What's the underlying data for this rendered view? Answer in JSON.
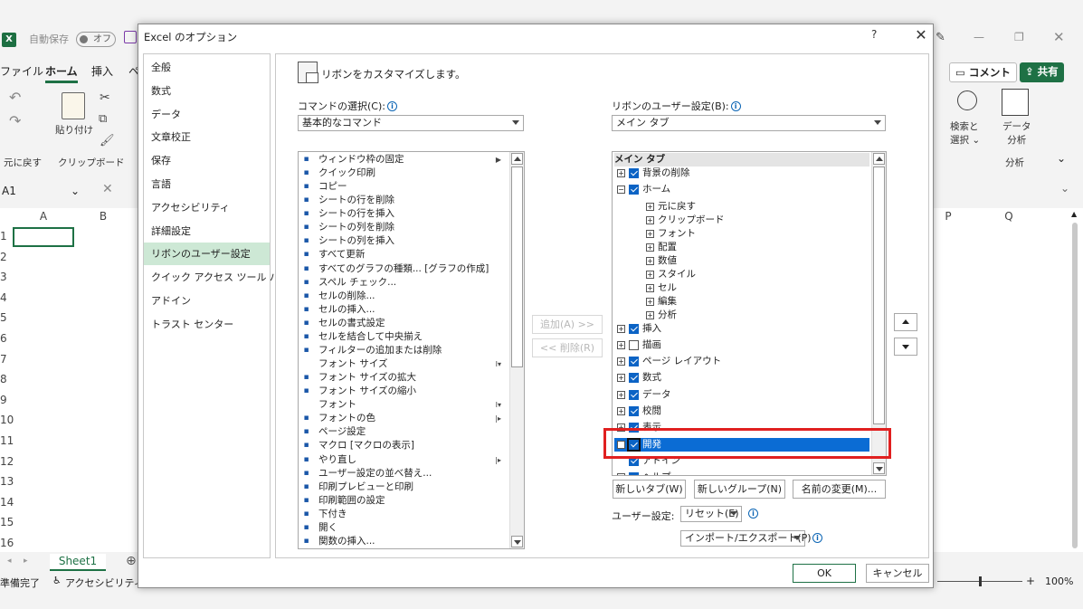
{
  "excel": {
    "app_icon": "excel-icon",
    "autosave_label": "自動保存",
    "autosave_state": "オフ",
    "menu_tabs": [
      "ファイル",
      "ホーム",
      "挿入"
    ],
    "undo_group_label": "元に戻す",
    "clipboard_group_label": "クリップボード",
    "paste_label": "貼り付け",
    "namebox_value": "A1",
    "columns": [
      "A",
      "B",
      "P",
      "Q"
    ],
    "rows": [
      "1",
      "2",
      "3",
      "4",
      "5",
      "6",
      "7",
      "8",
      "9",
      "10",
      "11",
      "12",
      "13",
      "14",
      "15",
      "16"
    ],
    "comment_button": "コメント",
    "share_button": "共有",
    "search_select_label": "検索と",
    "search_select_label2": "選択",
    "data_analysis_label": "データ",
    "data_analysis_label2": "分析",
    "analysis_group_label": "分析",
    "sheet_tab": "Sheet1",
    "status_ready": "準備完了",
    "status_accessibility": "アクセシビリティ: I",
    "zoom": "100%",
    "accent_green": "#1e7145"
  },
  "dialog": {
    "title": "Excel のオプション",
    "help": "?",
    "close": "✕",
    "nav": [
      "全般",
      "数式",
      "データ",
      "文章校正",
      "保存",
      "言語",
      "アクセシビリティ",
      "詳細設定",
      "リボンのユーザー設定",
      "クイック アクセス ツール バー",
      "アドイン",
      "トラスト センター"
    ],
    "nav_selected": "リボンのユーザー設定",
    "heading": "リボンをカスタマイズします。",
    "commands_label": "コマンドの選択(C):",
    "commands_value": "基本的なコマンド",
    "ribbon_label": "リボンのユーザー設定(B):",
    "ribbon_value": "メイン タブ",
    "commands": [
      {
        "icon": "freeze-panes-icon",
        "label": "ウィンドウ枠の固定",
        "sub": "▶"
      },
      {
        "icon": "quick-print-icon",
        "label": "クイック印刷",
        "sub": ""
      },
      {
        "icon": "copy-icon",
        "label": "コピー",
        "sub": ""
      },
      {
        "icon": "delete-sheet-rows-icon",
        "label": "シートの行を削除",
        "sub": ""
      },
      {
        "icon": "insert-sheet-rows-icon",
        "label": "シートの行を挿入",
        "sub": ""
      },
      {
        "icon": "delete-sheet-columns-icon",
        "label": "シートの列を削除",
        "sub": ""
      },
      {
        "icon": "insert-sheet-columns-icon",
        "label": "シートの列を挿入",
        "sub": ""
      },
      {
        "icon": "refresh-all-icon",
        "label": "すべて更新",
        "sub": ""
      },
      {
        "icon": "all-chart-types-icon",
        "label": "すべてのグラフの種類... [グラフの作成]",
        "sub": ""
      },
      {
        "icon": "spelling-icon",
        "label": "スペル チェック...",
        "sub": ""
      },
      {
        "icon": "delete-cells-icon",
        "label": "セルの削除...",
        "sub": ""
      },
      {
        "icon": "insert-cells-icon",
        "label": "セルの挿入...",
        "sub": ""
      },
      {
        "icon": "format-cells-icon",
        "label": "セルの書式設定",
        "sub": ""
      },
      {
        "icon": "merge-center-icon",
        "label": "セルを結合して中央揃え",
        "sub": ""
      },
      {
        "icon": "filter-icon",
        "label": "フィルターの追加または削除",
        "sub": ""
      },
      {
        "icon": "",
        "label": "フォント サイズ",
        "sub": "I▾"
      },
      {
        "icon": "font-size-increase-icon",
        "label": "フォント サイズの拡大",
        "sub": ""
      },
      {
        "icon": "font-size-decrease-icon",
        "label": "フォント サイズの縮小",
        "sub": ""
      },
      {
        "icon": "",
        "label": "フォント",
        "sub": "I▾"
      },
      {
        "icon": "font-color-icon",
        "label": "フォントの色",
        "sub": "|▸"
      },
      {
        "icon": "page-setup-icon",
        "label": "ページ設定",
        "sub": ""
      },
      {
        "icon": "macro-icon",
        "label": "マクロ [マクロの表示]",
        "sub": ""
      },
      {
        "icon": "redo-icon",
        "label": "やり直し",
        "sub": "|▸"
      },
      {
        "icon": "custom-sort-icon",
        "label": "ユーザー設定の並べ替え...",
        "sub": ""
      },
      {
        "icon": "print-preview-icon",
        "label": "印刷プレビューと印刷",
        "sub": ""
      },
      {
        "icon": "print-area-icon",
        "label": "印刷範囲の設定",
        "sub": ""
      },
      {
        "icon": "subscript-icon",
        "label": "下付き",
        "sub": ""
      },
      {
        "icon": "open-icon",
        "label": "開く",
        "sub": ""
      },
      {
        "icon": "insert-function-icon",
        "label": "関数の挿入...",
        "sub": ""
      }
    ],
    "add_button": "追加(A) >>",
    "remove_button": "<< 削除(R)",
    "tree_header": "メイン タブ",
    "tree": [
      {
        "label": "背景の削除",
        "level": 0,
        "pm": "⊞",
        "checked": true
      },
      {
        "label": "ホーム",
        "level": 0,
        "pm": "⊟",
        "checked": true
      },
      {
        "label": "元に戻す",
        "level": 1,
        "pm": "⊞",
        "checked": null
      },
      {
        "label": "クリップボード",
        "level": 1,
        "pm": "⊞",
        "checked": null
      },
      {
        "label": "フォント",
        "level": 1,
        "pm": "⊞",
        "checked": null
      },
      {
        "label": "配置",
        "level": 1,
        "pm": "⊞",
        "checked": null
      },
      {
        "label": "数値",
        "level": 1,
        "pm": "⊞",
        "checked": null
      },
      {
        "label": "スタイル",
        "level": 1,
        "pm": "⊞",
        "checked": null
      },
      {
        "label": "セル",
        "level": 1,
        "pm": "⊞",
        "checked": null
      },
      {
        "label": "編集",
        "level": 1,
        "pm": "⊞",
        "checked": null
      },
      {
        "label": "分析",
        "level": 1,
        "pm": "⊞",
        "checked": null
      },
      {
        "label": "挿入",
        "level": 0,
        "pm": "⊞",
        "checked": true
      },
      {
        "label": "描画",
        "level": 0,
        "pm": "⊞",
        "checked": false
      },
      {
        "label": "ページ レイアウト",
        "level": 0,
        "pm": "⊞",
        "checked": true
      },
      {
        "label": "数式",
        "level": 0,
        "pm": "⊞",
        "checked": true
      },
      {
        "label": "データ",
        "level": 0,
        "pm": "⊞",
        "checked": true
      },
      {
        "label": "校閲",
        "level": 0,
        "pm": "⊞",
        "checked": true
      },
      {
        "label": "表示",
        "level": 0,
        "pm": "⊞",
        "checked": true
      },
      {
        "label": "開発",
        "level": 0,
        "pm": "⊞",
        "checked": true,
        "selected": true
      },
      {
        "label": "アドイン",
        "level": 0,
        "pm": "",
        "checked": true
      },
      {
        "label": "ヘルプ",
        "level": 0,
        "pm": "⊞",
        "checked": true
      }
    ],
    "new_tab_button": "新しいタブ(W)",
    "new_group_button": "新しいグループ(N)",
    "rename_button": "名前の変更(M)...",
    "user_settings_label": "ユーザー設定:",
    "reset_button": "リセット(E)",
    "import_export_button": "インポート/エクスポート(P)",
    "ok_button": "OK",
    "cancel_button": "キャンセル",
    "selection_color": "#0b6cd4",
    "highlight_color": "#e02020",
    "nav_selected_color": "#cde8d5"
  }
}
